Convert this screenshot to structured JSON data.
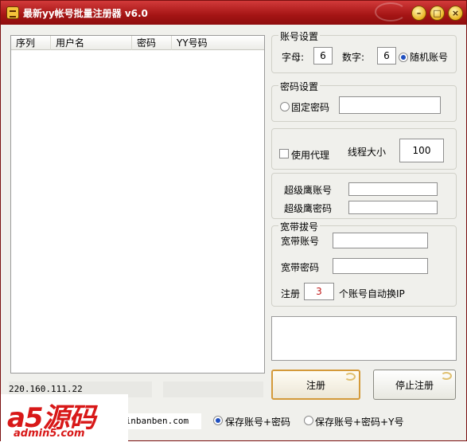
{
  "window": {
    "title": "最新yy帐号批量注册器 v6.0"
  },
  "list": {
    "columns": [
      "序列",
      "用户名",
      "密码",
      "YY号码"
    ]
  },
  "account_settings": {
    "legend": "账号设置",
    "letters_label": "字母:",
    "letters_value": "6",
    "digits_label": "数字:",
    "digits_value": "6",
    "random_label": "随机账号",
    "random_checked": true
  },
  "password_settings": {
    "legend": "密码设置",
    "fixed_label": "固定密码",
    "fixed_value": ""
  },
  "proxy": {
    "use_proxy_label": "使用代理",
    "thread_label": "线程大小",
    "thread_value": "100"
  },
  "super_eagle": {
    "account_label": "超级鹰账号",
    "password_label": "超级鹰密码"
  },
  "broadband": {
    "legend": "宽带拔号",
    "account_label": "宽带账号",
    "password_label": "宽带密码",
    "register_label": "注册",
    "register_count": "3",
    "switch_ip_label": "个账号自动换IP"
  },
  "actions": {
    "register": "注册",
    "stop": "停止注册"
  },
  "status": {
    "ip": "220.160.111.22",
    "url": "xinbanben.com",
    "save_option_1": "保存账号+密码",
    "save_option_2": "保存账号+密码+Y号"
  },
  "logo": {
    "main": "a5源码",
    "sub": "admin5.com"
  }
}
